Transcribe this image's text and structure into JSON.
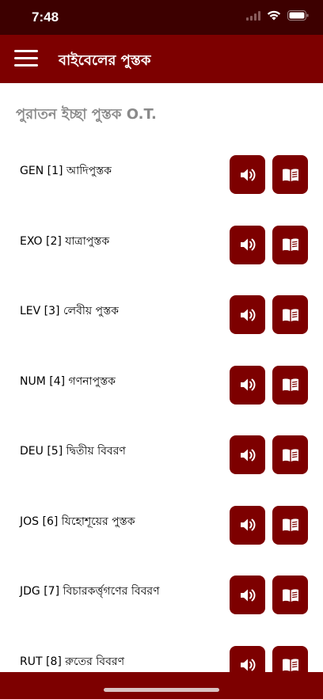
{
  "status_bar": {
    "time": "7:48"
  },
  "app_bar": {
    "title": "বাইবেলের পুস্তক"
  },
  "section": {
    "heading": "পুরাতন ইচ্ছা পুস্তক O.T."
  },
  "books": [
    {
      "label": "GEN [1] আদিপুস্তক"
    },
    {
      "label": "EXO [2] যাত্রাপুস্তক"
    },
    {
      "label": "LEV [3] লেবীয় পুস্তক"
    },
    {
      "label": "NUM [4] গণনাপুস্তক"
    },
    {
      "label": "DEU [5] দ্বিতীয় বিবরণ"
    },
    {
      "label": "JOS [6] যিহোশূয়ের পুস্তক"
    },
    {
      "label": "JDG [7] বিচারকর্ত্তৃগণের বিবরণ"
    },
    {
      "label": "RUT [8] রুতের বিবরণ"
    }
  ],
  "icons": {
    "audio": "speaker-icon",
    "read": "book-icon",
    "menu": "hamburger-menu-icon"
  },
  "colors": {
    "app_bar": "#7d0000",
    "status_bar": "#3d0000",
    "button": "#7d0000",
    "heading_text": "#8a8a8a"
  }
}
